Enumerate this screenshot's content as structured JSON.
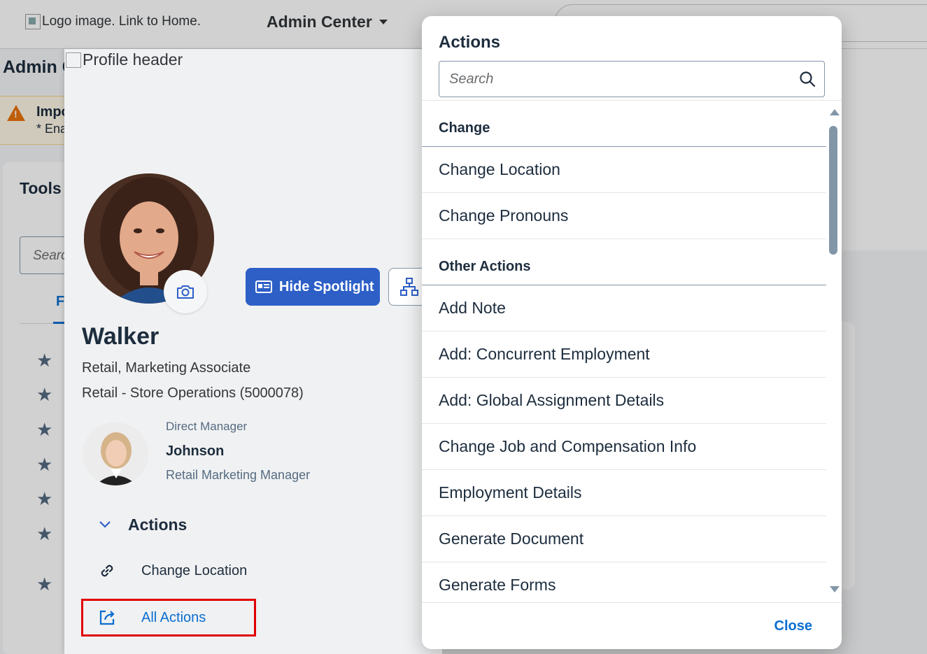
{
  "topbar": {
    "logo_alt": "Logo image. Link to Home.",
    "admin_menu_label": "Admin Center"
  },
  "background": {
    "page_title": "Admin C",
    "warning_title": "Impo",
    "warning_sub": "* Ena",
    "tools_title": "Tools",
    "tools_search_placeholder": "Searc",
    "tools_tab": "F"
  },
  "spotlight": {
    "header_alt": "Profile header",
    "hide_spotlight_label": "Hide Spotlight",
    "employee": {
      "name": "Walker",
      "job": "Retail, Marketing Associate",
      "department": "Retail - Store Operations (5000078)"
    },
    "manager": {
      "label": "Direct Manager",
      "name": "Johnson",
      "title": "Retail Marketing Manager"
    },
    "actions_heading": "Actions",
    "quick_actions": [
      {
        "label": "Change Location"
      },
      {
        "label": "All Actions"
      }
    ]
  },
  "dialog": {
    "title": "Actions",
    "search_placeholder": "Search",
    "groups": [
      {
        "header": "Change",
        "items": [
          "Change Location",
          "Change Pronouns"
        ]
      },
      {
        "header": "Other Actions",
        "items": [
          "Add Note",
          "Add: Concurrent Employment",
          "Add: Global Assignment Details",
          "Change Job and Compensation Info",
          "Employment Details",
          "Generate Document",
          "Generate Forms"
        ]
      }
    ],
    "close_label": "Close"
  },
  "colors": {
    "brand_blue": "#2d5fc7",
    "link_blue": "#0a6ed1",
    "highlight_red": "#e00000",
    "text_dark": "#1d2d3e"
  }
}
